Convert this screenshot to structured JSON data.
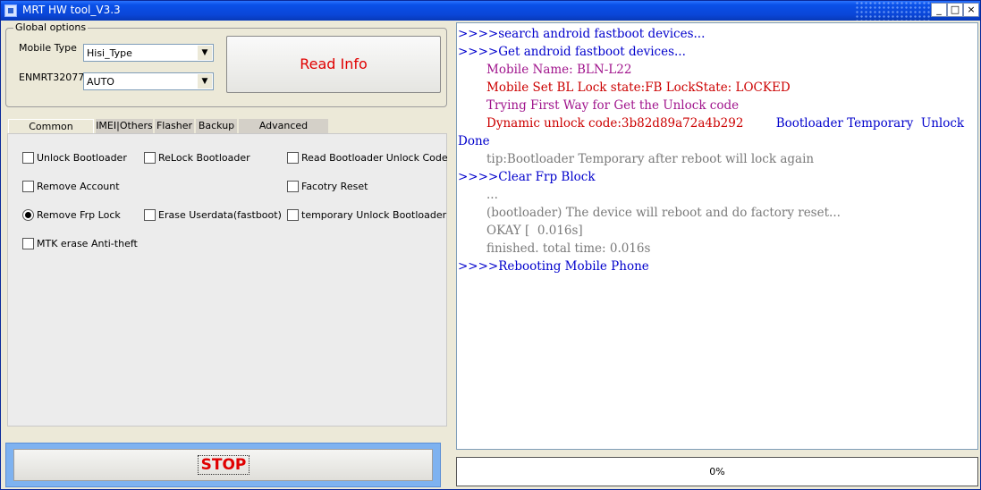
{
  "window": {
    "title": "MRT HW tool_V3.3"
  },
  "titlebar_buttons": {
    "minimize": "_",
    "restore": "□",
    "close": "×"
  },
  "global_options": {
    "label": "Global options",
    "mobile_type_label": "Mobile Type",
    "mobile_type_value": "Hisi_Type",
    "enmrt_label": "ENMRT32077",
    "enmrt_value": "AUTO",
    "read_info_label": "Read Info"
  },
  "tabs": [
    "Common functions",
    "IMEI|Others",
    "Flasher",
    "Backup",
    "Advanced function"
  ],
  "active_tab": "Common functions",
  "options": [
    {
      "label": "Unlock Bootloader",
      "type": "checkbox",
      "checked": false
    },
    {
      "label": "ReLock Bootloader",
      "type": "checkbox",
      "checked": false
    },
    {
      "label": "Read Bootloader Unlock Code",
      "type": "checkbox",
      "checked": false
    },
    {
      "label": "Remove Account",
      "type": "checkbox",
      "checked": false
    },
    {
      "label": "Facotry Reset",
      "type": "checkbox",
      "checked": false
    },
    {
      "label": "Remove Frp Lock",
      "type": "radio",
      "checked": true
    },
    {
      "label": "Erase Userdata(fastboot)",
      "type": "checkbox",
      "checked": false
    },
    {
      "label": "temporary Unlock Bootloader",
      "type": "checkbox",
      "checked": false
    },
    {
      "label": "MTK erase Anti-theft",
      "type": "checkbox",
      "checked": false
    }
  ],
  "stop_label": "STOP",
  "log_lines": [
    {
      "text": ">>>>search android fastboot devices...",
      "color": "#0000cc"
    },
    {
      "text": ">>>>Get android fastboot devices...",
      "color": "#0000cc"
    },
    {
      "text": "Mobile Name: BLN-L22",
      "color": "#a0148c"
    },
    {
      "text": "Mobile Set BL Lock state:FB LockState: LOCKED",
      "color": "#cc0000"
    },
    {
      "text": "Trying First Way for Get the Unlock code",
      "color": "#a0148c"
    },
    {
      "text": "Dynamic unlock code:3b82d89a72a4b292",
      "color": "#cc0000",
      "suffix": "Bootloader Temporary  Unlock",
      "suffix_color": "#0000cc"
    },
    {
      "text": "Done",
      "color": "#0000cc"
    },
    {
      "text": "tip:Bootloader Temporary after reboot will lock again",
      "color": "#7a7a7a"
    },
    {
      "text": ">>>>Clear Frp Block",
      "color": "#0000cc"
    },
    {
      "text": "...",
      "color": "#7a7a7a"
    },
    {
      "text": "(bootloader) The device will reboot and do factory reset...",
      "color": "#7a7a7a"
    },
    {
      "text": "OKAY [  0.016s]",
      "color": "#7a7a7a"
    },
    {
      "text": "finished. total time: 0.016s",
      "color": "#7a7a7a"
    },
    {
      "text": ">>>>Rebooting Mobile Phone",
      "color": "#0000cc"
    }
  ],
  "progress": {
    "percent": 0,
    "label": "0%"
  }
}
